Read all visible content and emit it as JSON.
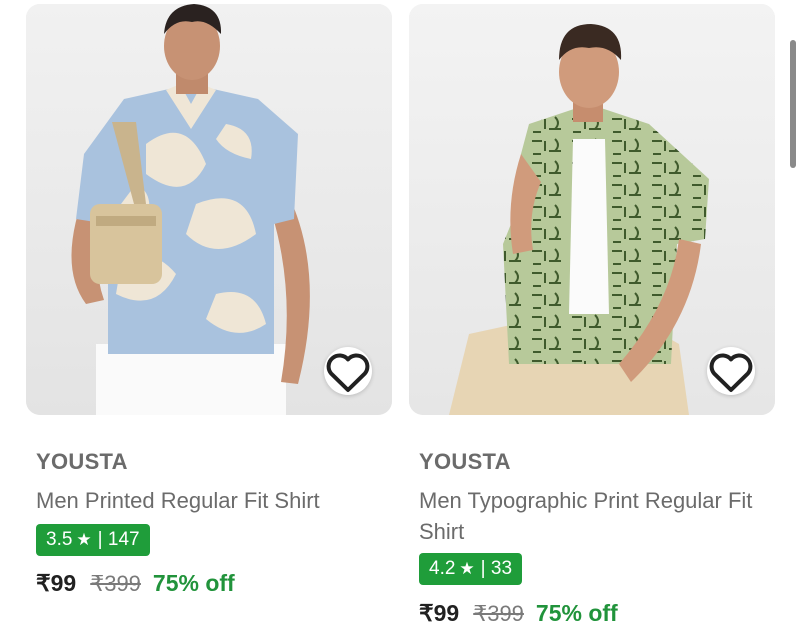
{
  "products": [
    {
      "brand": "YOUSTA",
      "title": "Men Printed Regular Fit Shirt",
      "rating": "3.5",
      "rating_count": "147",
      "price": "₹99",
      "mrp": "₹399",
      "discount": "75% off",
      "wishlist_icon": "heart-outline-icon"
    },
    {
      "brand": "YOUSTA",
      "title": "Men Typographic Print Regular Fit Shirt",
      "rating": "4.2",
      "rating_count": "33",
      "price": "₹99",
      "mrp": "₹399",
      "discount": "75% off",
      "wishlist_icon": "heart-outline-icon"
    }
  ],
  "colors": {
    "rating_badge": "#1f9d3a",
    "discount": "#21933b",
    "text_muted": "#6b6b6b"
  }
}
